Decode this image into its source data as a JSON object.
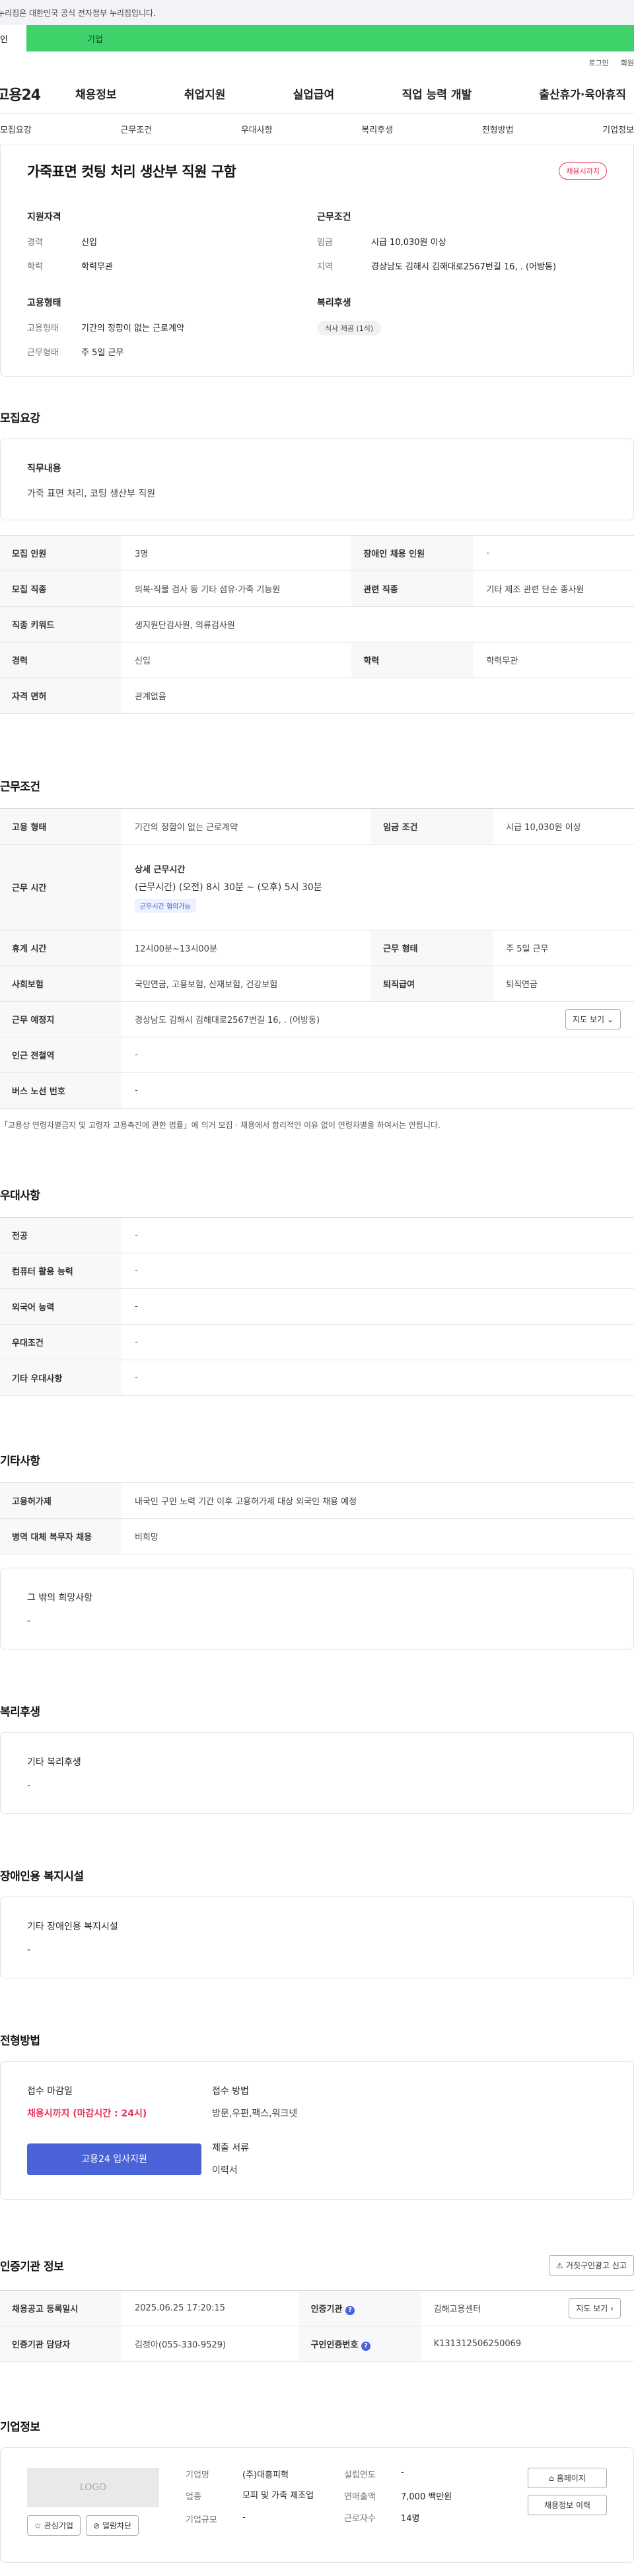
{
  "topbar": {
    "notice": "누리집은 대한민국 공식 전자정부 누리집입니다."
  },
  "tabs": {
    "personal": "인",
    "business": "기업"
  },
  "util": {
    "login": "로그인",
    "signup": "회원"
  },
  "gnb": {
    "logo": "고용24",
    "menu": [
      "채용정보",
      "취업지원",
      "실업급여",
      "직업 능력 개발",
      "출산휴가·육아휴직"
    ]
  },
  "subnav": [
    "모집요강",
    "근무조건",
    "우대사항",
    "복리후생",
    "전형방법",
    "기업정보"
  ],
  "summary": {
    "title": "가죽표면 컷팅 처리 생산부 직원 구함",
    "status_badge": "채용시까지",
    "qualification_title": "지원자격",
    "career_label": "경력",
    "career_value": "신입",
    "education_label": "학력",
    "education_value": "학력무관",
    "work_title": "근무조건",
    "wage_label": "임금",
    "wage_value": "시급 10,030원 이상",
    "region_label": "지역",
    "region_value": "경상남도 김해시 김해대로2567번길 16, . (어방동)",
    "employment_title": "고용형태",
    "emp_type_label": "고용형태",
    "emp_type_value": "기간의 정함이 없는 근로계약",
    "work_type_label": "근무형태",
    "work_type_value": "주 5일 근무",
    "welfare_title": "복리후생",
    "welfare_chip": "식사 제공 (1식)"
  },
  "requirements": {
    "title": "모집요강",
    "job_desc_label": "직무내용",
    "job_desc_value": "가죽 표면 처리, 코팅 생산부 직원",
    "rows": {
      "headcount_label": "모집 인원",
      "headcount_value": "3명",
      "disabled_label": "장애인 채용 인원",
      "disabled_value": "-",
      "occupation_label": "모집 직종",
      "occupation_value": "의복·직물 검사 등 기타 섬유·가죽 기능원",
      "related_label": "관련 직종",
      "related_value": "기타 제조 관련 단순 종사원",
      "keyword_label": "직종 키워드",
      "keyword_value": "생지원단검사원, 의류검사원",
      "career_label": "경력",
      "career_value": "신입",
      "edu_label": "학력",
      "edu_value": "학력무관",
      "license_label": "자격 면허",
      "license_value": "관계없음"
    }
  },
  "conditions": {
    "title": "근무조건",
    "emp_type_label": "고용 형태",
    "emp_type_value": "기간의 정함이 없는 근로계약",
    "wage_label": "임금 조건",
    "wage_value": "시급 10,030원 이상",
    "hours_label": "근무 시간",
    "hours_detail_title": "상세 근무시간",
    "hours_detail_value": "(근무시간) (오전) 8시 30분 ~ (오후) 5시 30분",
    "hours_tag": "근무시간 협의가능",
    "break_label": "휴게 시간",
    "break_value": "12시00분~13시00분",
    "work_type_label": "근무 형태",
    "work_type_value": "주 5일 근무",
    "insurance_label": "사회보험",
    "insurance_value": "국민연금, 고용보험, 산재보험, 건강보험",
    "severance_label": "퇴직급여",
    "severance_value": "퇴직연금",
    "location_label": "근무 예정지",
    "location_value": "경상남도 김해시 김해대로2567번길 16, . (어방동)",
    "map_button": "지도 보기",
    "station_label": "인근 전철역",
    "station_value": "-",
    "bus_label": "버스 노선 번호",
    "bus_value": "-",
    "legal_note": "「고용상 연령차별금지 및 고령자 고용촉진에 관한 법률」에 의거 모집 · 채용에서 합리적인 이유 없이 연령차별을 하여서는 안됩니다."
  },
  "preferences": {
    "title": "우대사항",
    "major_label": "전공",
    "major_value": "-",
    "computer_label": "컴퓨터 활용 능력",
    "computer_value": "-",
    "language_label": "외국어 능력",
    "language_value": "-",
    "condition_label": "우대조건",
    "condition_value": "-",
    "other_label": "기타 우대사항",
    "other_value": "-"
  },
  "others": {
    "title": "기타사항",
    "permit_label": "고용허가제",
    "permit_value": "내국인 구인 노력 기간 이후 고용허가제 대상 외국인 채용 예정",
    "military_label": "병역 대체 복무자 채용",
    "military_value": "비희망",
    "etc_label": "그 밖의 희망사항",
    "etc_value": "-"
  },
  "welfare": {
    "title": "복리후생",
    "label": "기타 복리후생",
    "value": "-"
  },
  "disability": {
    "title": "장애인용 복지시설",
    "label": "기타 장애인용 복지시설",
    "value": "-"
  },
  "selection": {
    "title": "전형방법",
    "deadline_label": "접수 마감일",
    "deadline_value": "채용시까지 (마감시간 : 24시)",
    "apply_button": "고용24 입사지원",
    "method_label": "접수 방법",
    "method_value": "방문,우편,팩스,워크넷",
    "docs_label": "제출 서류",
    "docs_value": "이력서"
  },
  "agency": {
    "title": "인증기관 정보",
    "report_button": "거짓구인광고 신고",
    "registered_label": "채용공고 등록일시",
    "registered_value": "2025.06.25 17:20:15",
    "agency_label": "인증기관",
    "agency_value": "김해고용센터",
    "map_button": "지도 보기",
    "manager_label": "인증기관 담당자",
    "manager_value": "김정아(055-330-9529)",
    "number_label": "구인인증번호",
    "number_value": "K131312506250069"
  },
  "company": {
    "title": "기업정보",
    "logo_text": "LOGO",
    "interest_button": "관심기업",
    "block_button": "열람차단",
    "name_label": "기업명",
    "name_value": "(주)대흥피혁",
    "industry_label": "업종",
    "industry_value": "모피 및 가죽 제조업",
    "size_label": "기업규모",
    "size_value": "-",
    "founded_label": "설립연도",
    "founded_value": "-",
    "sales_label": "연매출액",
    "sales_value": "7,000 백만원",
    "employees_label": "근로자수",
    "employees_value": "14명",
    "homepage_button": "홈페이지",
    "history_button": "채용정보 이력"
  },
  "colors": {
    "green": "#3fd16a",
    "red": "#e8335d",
    "blue": "#4a63d9"
  }
}
